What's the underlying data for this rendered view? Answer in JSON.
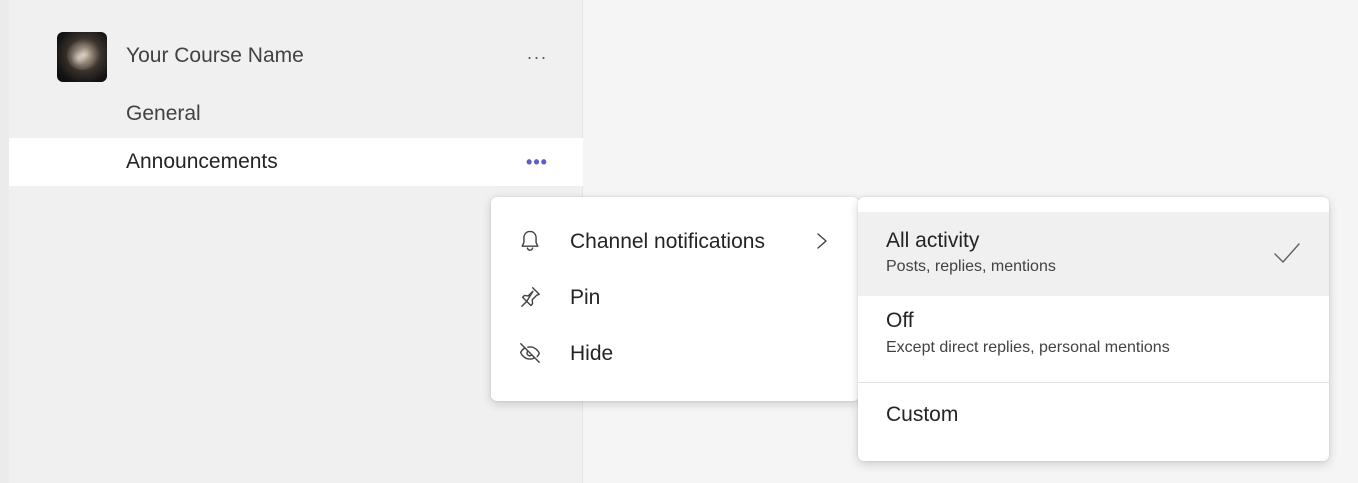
{
  "team": {
    "name": "Your Course Name",
    "more_label": "···",
    "avatar_icon": "team-avatar-image"
  },
  "channels": [
    {
      "name": "General"
    },
    {
      "name": "Announcements",
      "more_label": "•••",
      "selected": true
    }
  ],
  "context_menu": {
    "items": [
      {
        "label": "Channel notifications",
        "icon": "bell-icon",
        "has_submenu": true
      },
      {
        "label": "Pin",
        "icon": "pin-icon"
      },
      {
        "label": "Hide",
        "icon": "eye-off-icon"
      }
    ]
  },
  "notifications_submenu": {
    "options": [
      {
        "title": "All activity",
        "description": "Posts, replies, mentions",
        "selected": true
      },
      {
        "title": "Off",
        "description": "Except direct replies, personal mentions"
      },
      {
        "title": "Custom"
      }
    ]
  },
  "colors": {
    "accent": "#5b5fc7",
    "sidebar_bg": "#f0f0f0",
    "content_bg": "#f5f5f5",
    "selected_bg": "#ffffff",
    "hover_bg": "#f0f0f0"
  }
}
